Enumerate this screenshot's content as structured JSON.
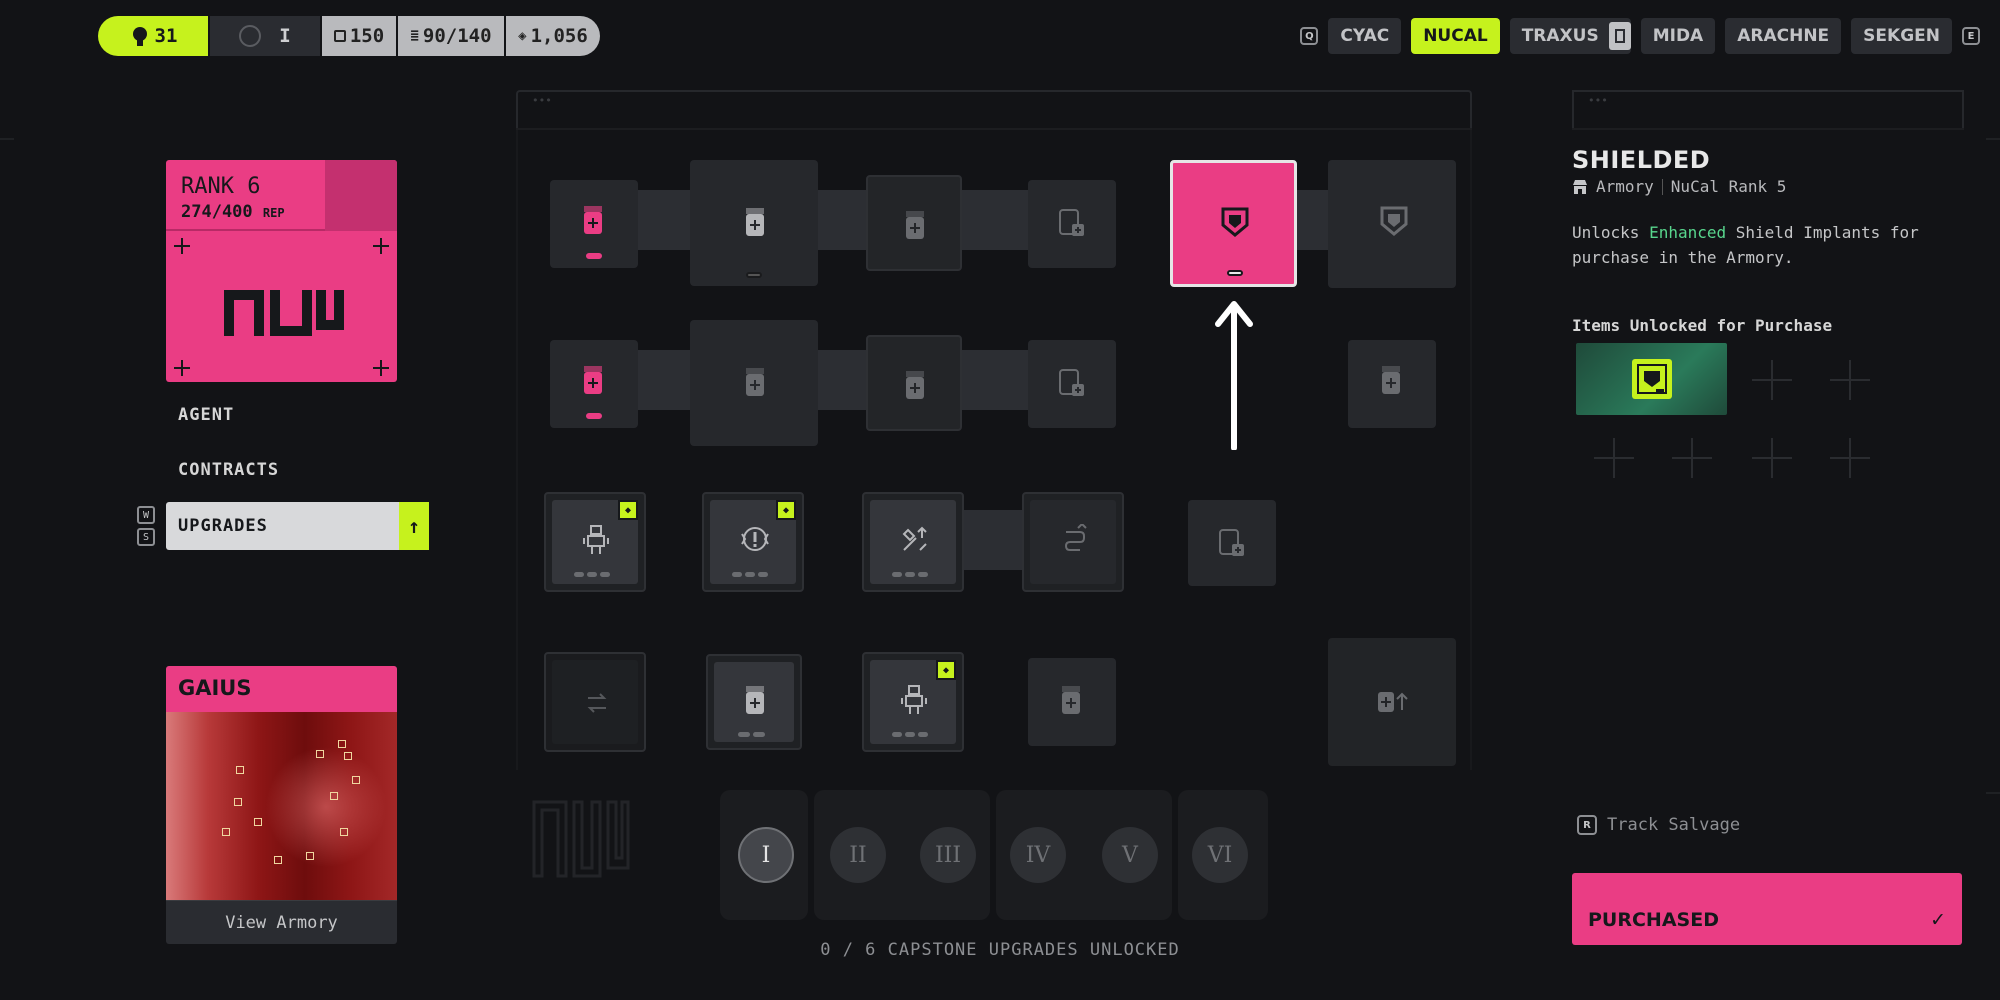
{
  "topbar": {
    "rank_value": "31",
    "level_value": "I",
    "currency_1": "150",
    "currency_2": "90/140",
    "currency_3": "1,056"
  },
  "factions": {
    "left_key": "Q",
    "right_key": "E",
    "items": [
      {
        "label": "CYAC",
        "active": false
      },
      {
        "label": "NUCAL",
        "active": true
      },
      {
        "label": "TRAXUS",
        "active": false
      },
      {
        "label": "MIDA",
        "active": false
      },
      {
        "label": "ARACHNE",
        "active": false
      },
      {
        "label": "SEKGEN",
        "active": false
      }
    ]
  },
  "rank_card": {
    "title": "RANK 6",
    "rep": "274/400",
    "rep_unit": "REP"
  },
  "nav": {
    "items": [
      {
        "label": "AGENT"
      },
      {
        "label": "CONTRACTS"
      },
      {
        "label": "UPGRADES"
      }
    ],
    "key_up": "W",
    "key_down": "S"
  },
  "gaius": {
    "title": "GAIUS",
    "button": "View Armory"
  },
  "tiers": [
    "I",
    "II",
    "III",
    "IV",
    "V",
    "VI"
  ],
  "capstone": "0 / 6 CAPSTONE UPGRADES UNLOCKED",
  "detail": {
    "title": "SHIELDED",
    "source": "Armory",
    "rank_req": "NuCal Rank 5",
    "desc_pre": "Unlocks ",
    "desc_hl": "Enhanced",
    "desc_post": " Shield Implants for purchase in the Armory.",
    "unlock_label": "Items Unlocked for Purchase",
    "track_key": "R",
    "track_label": "Track Salvage",
    "purchase_label": "PURCHASED",
    "purchase_check": "✓"
  },
  "colors": {
    "accent_lime": "#c6f21d",
    "accent_pink": "#ea3d84",
    "background": "#121316"
  }
}
